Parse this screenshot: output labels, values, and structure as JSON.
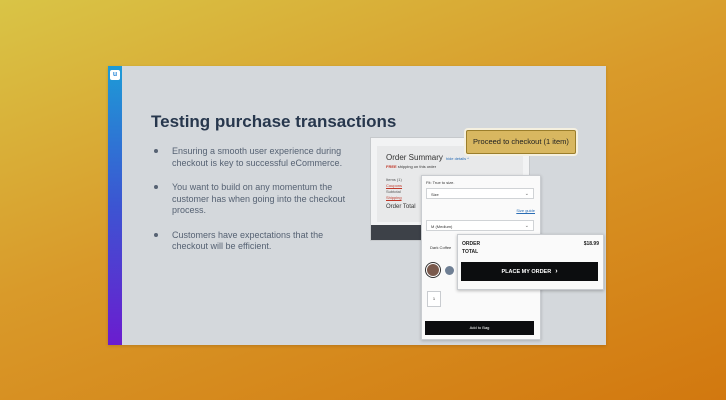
{
  "slide": {
    "title": "Testing purchase transactions",
    "logo_icon": "u",
    "bullets": [
      "Ensuring a smooth user experience during checkout is key to successful eCommerce.",
      "You want to build on any momentum the customer has when going into the checkout process.",
      "Customers have expectations that the checkout will be efficient."
    ]
  },
  "order_summary": {
    "title": "Order Summary",
    "edit": "hide details ^",
    "free_shipping_bold": "FREE",
    "free_shipping_rest": " shipping on this order",
    "items": "Items (1)",
    "coupons": "Coupons",
    "subtotal": "Subtotal",
    "shipping": "Shipping",
    "total": "Order Total"
  },
  "proceed_button": "Proceed to checkout (1 item)",
  "product": {
    "fit": "Fit: True to size.",
    "size_placeholder": "Size",
    "size_guide": "Size guide",
    "size_selected": "M (Medium)",
    "color_label": "Dark Coffee",
    "quantity": "1",
    "add_to_bag": "Add to Bag"
  },
  "order_card": {
    "label": "ORDER",
    "amount": "$18.99",
    "total_label": "TOTAL",
    "place_order": "PLACE MY ORDER",
    "chevron": "›"
  }
}
